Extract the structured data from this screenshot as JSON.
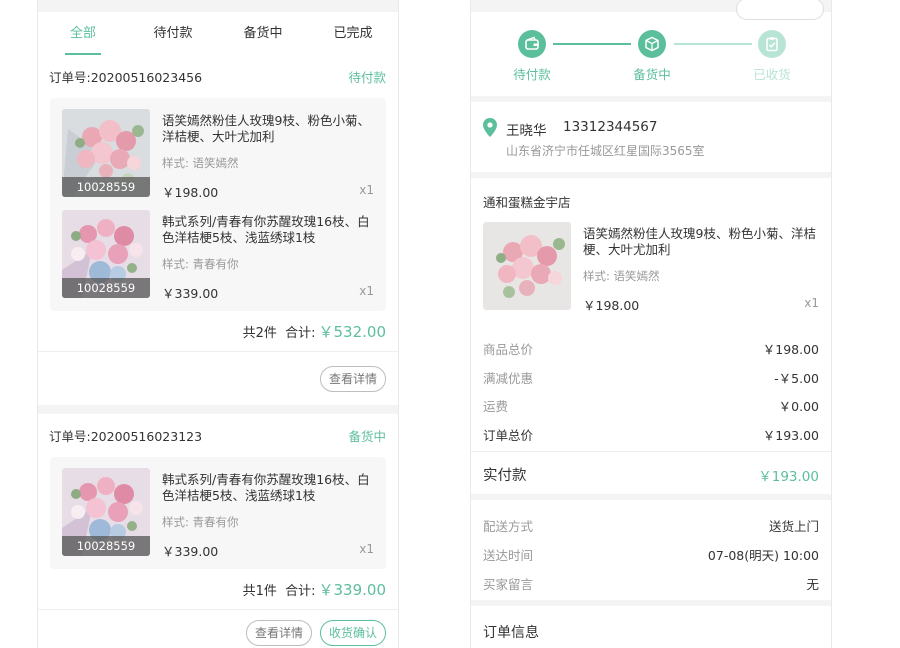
{
  "tabs": [
    {
      "label": "全部"
    },
    {
      "label": "待付款"
    },
    {
      "label": "备货中"
    },
    {
      "label": "已完成"
    }
  ],
  "orders": [
    {
      "number": "订单号:20200516023456",
      "status": "待付款",
      "items": [
        {
          "code": "10028559",
          "title": "语笑嫣然粉佳人玫瑰9枝、粉色小菊、洋桔梗、大叶尤加利",
          "spec": "样式: 语笑嫣然",
          "price": "￥198.00",
          "qty": "x1"
        },
        {
          "code": "10028559",
          "title": "韩式系列/青春有你苏醒玫瑰16枝、白色洋桔梗5枝、浅蓝绣球1枝",
          "spec": "样式: 青春有你",
          "price": "￥339.00",
          "qty": "x1"
        }
      ],
      "count": "共2件",
      "total_label": "合计:",
      "total": "￥532.00",
      "buttons": [
        "查看详情"
      ]
    },
    {
      "number": "订单号:20200516023123",
      "status": "备货中",
      "items": [
        {
          "code": "10028559",
          "title": "韩式系列/青春有你苏醒玫瑰16枝、白色洋桔梗5枝、浅蓝绣球1枝",
          "spec": "样式: 青春有你",
          "price": "￥339.00",
          "qty": "x1"
        }
      ],
      "count": "共1件",
      "total_label": "合计:",
      "total": "￥339.00",
      "buttons": [
        "查看详情",
        "收货确认"
      ]
    }
  ],
  "detail": {
    "steps": [
      {
        "label": "待付款",
        "icon": "wallet-icon",
        "active": true
      },
      {
        "label": "备货中",
        "icon": "package-icon",
        "active": true
      },
      {
        "label": "已收货",
        "icon": "clipboard-check-icon",
        "active": false
      }
    ],
    "address": {
      "name": "王晓华",
      "phone": "13312344567",
      "address": "山东省济宁市任城区红星国际3565室"
    },
    "shop": "通和蛋糕金宇店",
    "item": {
      "title": "语笑嫣然粉佳人玫瑰9枝、粉色小菊、洋桔梗、大叶尤加利",
      "spec": "样式: 语笑嫣然",
      "price": "￥198.00",
      "qty": "x1"
    },
    "fees": [
      {
        "k": "商品总价",
        "v": "￥198.00"
      },
      {
        "k": "满减优惠",
        "v": "-￥5.00"
      },
      {
        "k": "运费",
        "v": "￥0.00"
      },
      {
        "k": "订单总价",
        "v": "￥193.00"
      }
    ],
    "paid_label": "实付款",
    "paid": "￥193.00",
    "delivery": [
      {
        "k": "配送方式",
        "v": "送货上门"
      },
      {
        "k": "送达时间",
        "v": "07-08(明天) 10:00"
      },
      {
        "k": "买家留言",
        "v": "无"
      }
    ],
    "order_info_title": "订单信息"
  },
  "colors": {
    "accent": "#5cbf9c",
    "accent_light": "#b8e4d5"
  }
}
